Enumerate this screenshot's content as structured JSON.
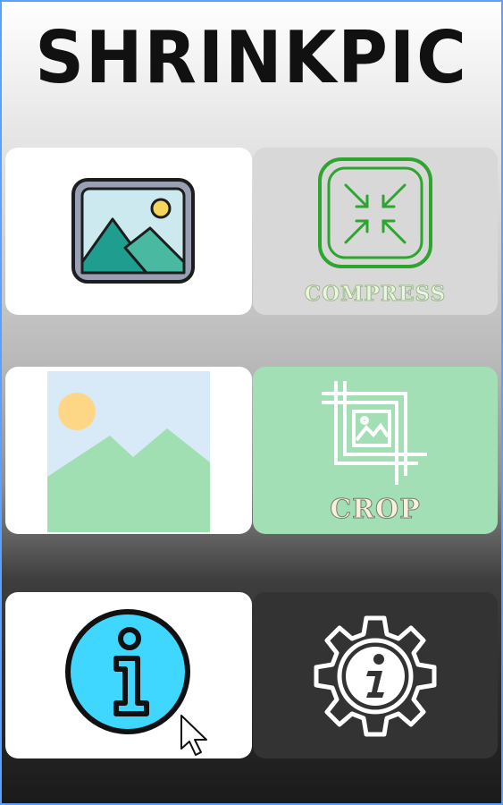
{
  "app": {
    "title": "SHRINKPIC"
  },
  "tiles": {
    "select_image": {
      "icon": "image-gallery-icon"
    },
    "compress": {
      "label": "COMPRESS",
      "icon": "compress-arrows-icon",
      "color": "#2ea52e"
    },
    "image_preview": {
      "icon": "landscape-placeholder-icon"
    },
    "crop": {
      "label": "CROP",
      "icon": "crop-icon"
    },
    "info": {
      "icon": "info-icon",
      "color": "#3fd6ff"
    },
    "settings": {
      "icon": "gear-info-icon"
    }
  },
  "colors": {
    "title": "#111111",
    "compress_tile": "#d8d8d8",
    "crop_tile": "#a3dfb5",
    "settings_tile": "#333333"
  }
}
